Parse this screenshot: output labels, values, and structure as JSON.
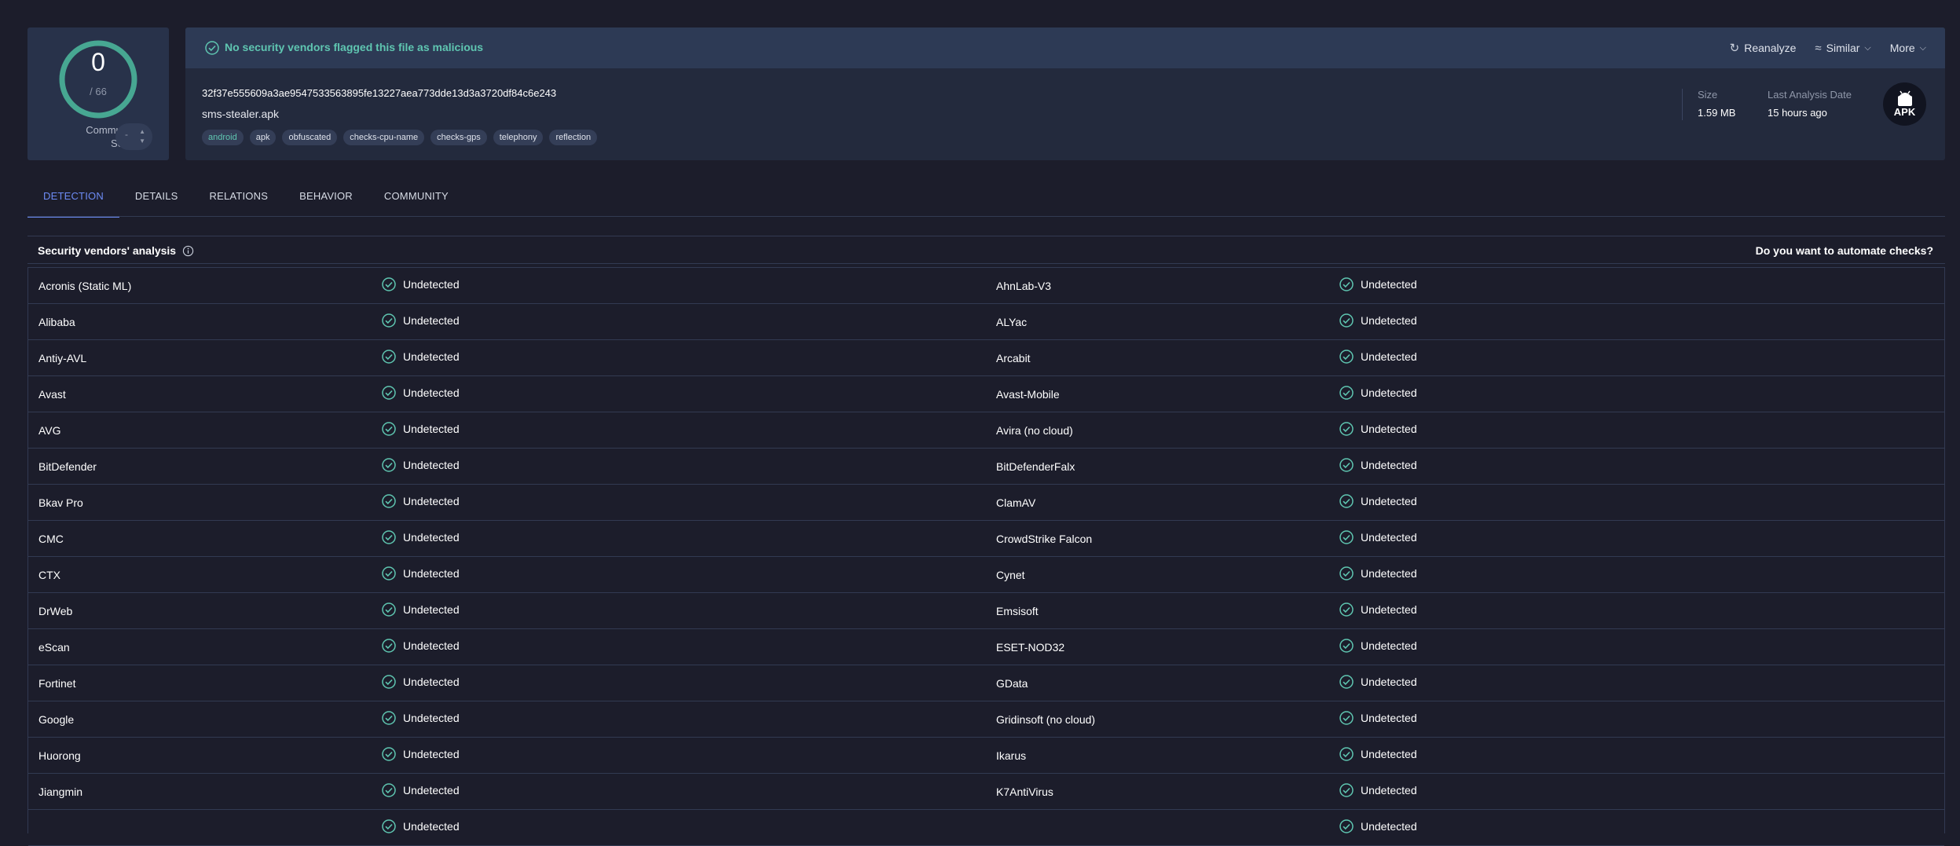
{
  "score": {
    "detections": "0",
    "total": "/ 66",
    "community_label_1": "Community",
    "community_label_2": "Score",
    "community_value": "-"
  },
  "alert": {
    "text": "No security vendors flagged this file as malicious"
  },
  "actions": [
    {
      "label": "Reanalyze",
      "icon": "refresh-icon"
    },
    {
      "label": "Similar",
      "icon": "similar-icon"
    },
    {
      "label": "More",
      "icon": "chevron-down-icon"
    }
  ],
  "file": {
    "hash": "32f37e555609a3ae9547533563895fe13227aea773dde13d3a3720df84c6e243",
    "name": "sms-stealer.apk",
    "tags": [
      "android",
      "apk",
      "obfuscated",
      "checks-cpu-name",
      "checks-gps",
      "telephony",
      "reflection"
    ]
  },
  "meta": {
    "size_label": "Size",
    "size_value": "1.59 MB",
    "date_label": "Last Analysis Date",
    "date_value": "15 hours ago",
    "file_type": "APK"
  },
  "tabs": [
    "DETECTION",
    "DETAILS",
    "RELATIONS",
    "BEHAVIOR",
    "COMMUNITY"
  ],
  "vendors": {
    "title": "Security vendors' analysis",
    "automate": "Do you want to automate checks?",
    "rows": [
      [
        "Acronis (Static ML)",
        "Undetected",
        "AhnLab-V3",
        "Undetected"
      ],
      [
        "Alibaba",
        "Undetected",
        "ALYac",
        "Undetected"
      ],
      [
        "Antiy-AVL",
        "Undetected",
        "Arcabit",
        "Undetected"
      ],
      [
        "Avast",
        "Undetected",
        "Avast-Mobile",
        "Undetected"
      ],
      [
        "AVG",
        "Undetected",
        "Avira (no cloud)",
        "Undetected"
      ],
      [
        "BitDefender",
        "Undetected",
        "BitDefenderFalx",
        "Undetected"
      ],
      [
        "Bkav Pro",
        "Undetected",
        "ClamAV",
        "Undetected"
      ],
      [
        "CMC",
        "Undetected",
        "CrowdStrike Falcon",
        "Undetected"
      ],
      [
        "CTX",
        "Undetected",
        "Cynet",
        "Undetected"
      ],
      [
        "DrWeb",
        "Undetected",
        "Emsisoft",
        "Undetected"
      ],
      [
        "eScan",
        "Undetected",
        "ESET-NOD32",
        "Undetected"
      ],
      [
        "Fortinet",
        "Undetected",
        "GData",
        "Undetected"
      ],
      [
        "Google",
        "Undetected",
        "Gridinsoft (no cloud)",
        "Undetected"
      ],
      [
        "Huorong",
        "Undetected",
        "Ikarus",
        "Undetected"
      ],
      [
        "Jiangmin",
        "Undetected",
        "K7AntiVirus",
        "Undetected"
      ],
      [
        "",
        "Undetected",
        "",
        "Undetected"
      ]
    ]
  },
  "colors": {
    "accent": "#6d8cf5",
    "clean": "#5fc6b1",
    "background": "#1c1d2b",
    "panel": "#232a3d"
  }
}
